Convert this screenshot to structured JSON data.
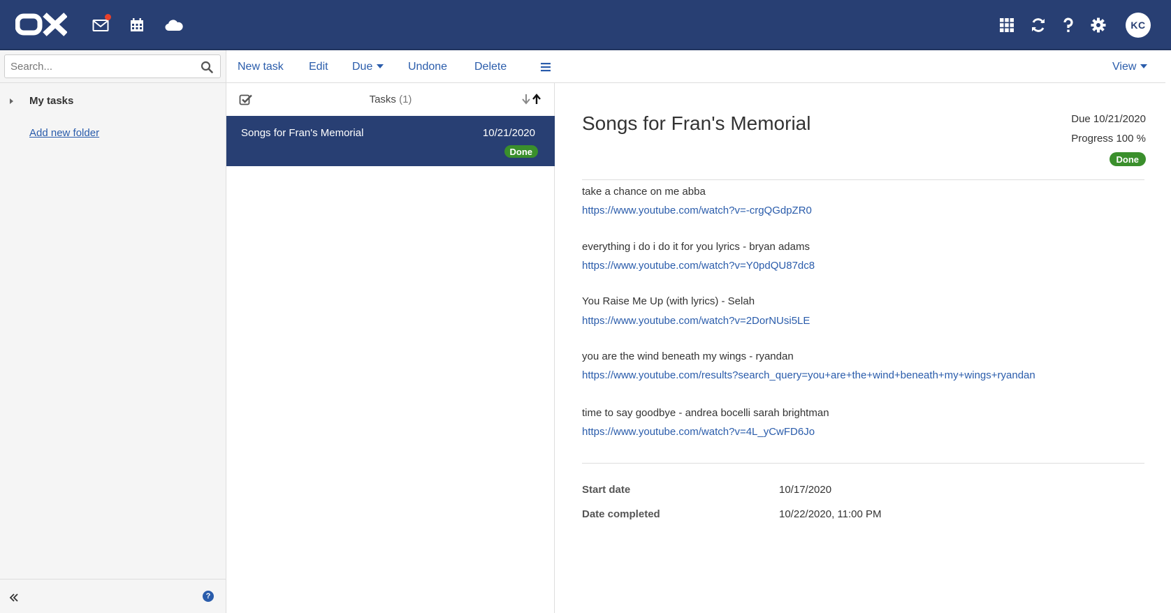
{
  "header": {
    "logo_text": "OX",
    "icons": [
      "mail-icon",
      "calendar-icon",
      "cloud-icon",
      "apps-grid-icon",
      "refresh-icon",
      "help-icon",
      "settings-icon"
    ],
    "avatar_initials": "KC",
    "colors": {
      "bar": "#283f73",
      "notification": "#e8412b"
    }
  },
  "sidebar": {
    "search_placeholder": "Search...",
    "folder_label": "My tasks",
    "add_folder_label": "Add new folder"
  },
  "toolbar": {
    "new_task": "New task",
    "edit": "Edit",
    "due": "Due",
    "undone": "Undone",
    "delete": "Delete",
    "view": "View"
  },
  "list": {
    "title": "Tasks",
    "count": "(1)",
    "items": [
      {
        "title": "Songs for Fran's Memorial",
        "date": "10/21/2020",
        "status": "Done"
      }
    ]
  },
  "detail": {
    "title": "Songs for Fran's Memorial",
    "due": "Due 10/21/2020",
    "progress": "Progress 100 %",
    "status": "Done",
    "notes": [
      {
        "text": "take a chance on me abba",
        "link": "https://www.youtube.com/watch?v=-crgQGdpZR0"
      },
      {
        "text": "everything i do i do it for you lyrics - bryan adams",
        "link": "https://www.youtube.com/watch?v=Y0pdQU87dc8"
      },
      {
        "text": "You Raise Me Up (with lyrics) - Selah",
        "link": "https://www.youtube.com/watch?v=2DorNUsi5LE"
      },
      {
        "text": "you are the wind beneath my wings - ryandan",
        "link": "https://www.youtube.com/results?search_query=you+are+the+wind+beneath+my+wings+ryandan"
      },
      {
        "text": "time to say goodbye - andrea bocelli sarah brightman",
        "link": "https://www.youtube.com/watch?v=4L_yCwFD6Jo"
      }
    ],
    "start_date_label": "Start date",
    "start_date_value": "10/17/2020",
    "date_completed_label": "Date completed",
    "date_completed_value": "10/22/2020, 11:00 PM",
    "colors": {
      "done_badge": "#3a8f2c",
      "link": "#2a5cab"
    }
  }
}
